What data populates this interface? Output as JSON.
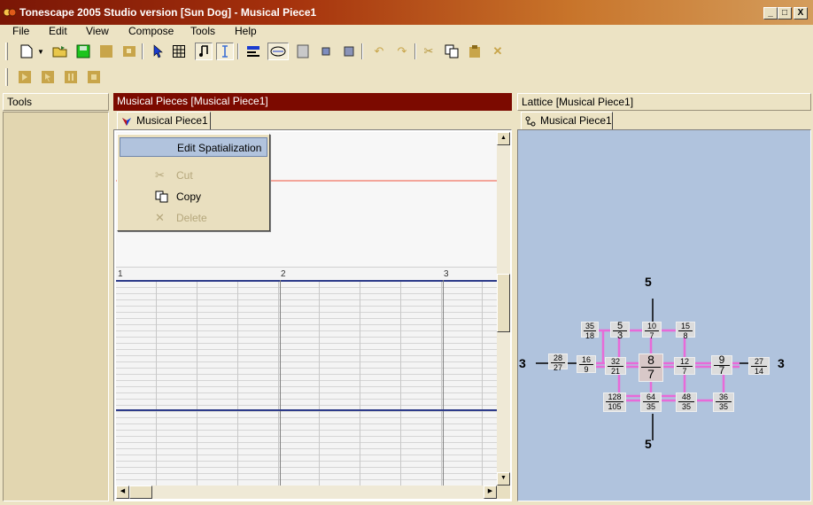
{
  "window": {
    "title": "Tonescape 2005 Studio  version [Sun Dog]  -  Musical Piece1",
    "controls": {
      "minimize": "_",
      "maximize": "□",
      "close": "X"
    }
  },
  "menu": [
    {
      "label": "File"
    },
    {
      "label": "Edit"
    },
    {
      "label": "View"
    },
    {
      "label": "Compose"
    },
    {
      "label": "Tools"
    },
    {
      "label": "Help"
    }
  ],
  "panels": {
    "tools": {
      "title": "Tools"
    },
    "pieces": {
      "title": "Musical Pieces  [Musical Piece1]",
      "tab": "Musical Piece1"
    },
    "lattice": {
      "title": "Lattice  [Musical Piece1]",
      "tab": "Musical Piece1"
    }
  },
  "ruler": {
    "marks": [
      "1",
      "2",
      "3"
    ]
  },
  "context_menu": {
    "items": [
      {
        "label": "Edit Spatialization",
        "enabled": true,
        "highlighted": true
      },
      {
        "label": "Cut",
        "enabled": false,
        "icon": "scissors-icon"
      },
      {
        "label": "Copy",
        "enabled": true,
        "icon": "copy-icon"
      },
      {
        "label": "Delete",
        "enabled": false,
        "icon": "delete-x-icon"
      }
    ]
  },
  "lattice": {
    "axis_labels": {
      "top": "5",
      "bottom": "5",
      "left": "3",
      "right": "3"
    },
    "nodes": [
      {
        "num": "35",
        "den": "18"
      },
      {
        "num": "5",
        "den": "3"
      },
      {
        "num": "10",
        "den": "7"
      },
      {
        "num": "15",
        "den": "8"
      },
      {
        "num": "28",
        "den": "27"
      },
      {
        "num": "16",
        "den": "9"
      },
      {
        "num": "32",
        "den": "21"
      },
      {
        "num": "8",
        "den": "7"
      },
      {
        "num": "12",
        "den": "7"
      },
      {
        "num": "9",
        "den": "7"
      },
      {
        "num": "27",
        "den": "14"
      },
      {
        "num": "128",
        "den": "105"
      },
      {
        "num": "64",
        "den": "35"
      },
      {
        "num": "48",
        "den": "35"
      },
      {
        "num": "36",
        "den": "35"
      }
    ]
  },
  "colors": {
    "title_start": "#7a1606",
    "panel_header_active": "#7c0a00",
    "lattice_bg": "#b0c3dd",
    "lattice_edges": "#e86ad8",
    "menu_highlight": "#b1c3dd"
  }
}
